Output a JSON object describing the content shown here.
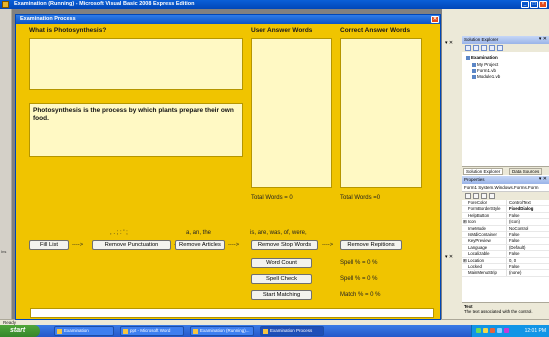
{
  "vs_window": {
    "title": "Examination (Running) - Microsoft Visual Basic 2008 Express Edition",
    "status": "Ready"
  },
  "form": {
    "title": "Examination Process",
    "question_label": "What is Photosynthesis?",
    "answer_text": "Photosynthesis is the process by which plants prepare their own food.",
    "user_words_label": "User Answer Words",
    "correct_words_label": "Correct Answer Words",
    "user_total": "Total Words = 0",
    "correct_total": "Total Words =0",
    "punct_hint": ", . ; : ' ;",
    "articles_hint": "a, an, the",
    "stopwords_hint": "is, are, was, of, were,",
    "buttons": {
      "fill_list": "Fill List",
      "remove_punct": "Remove Punctuation",
      "remove_articles": "Remove Articles",
      "remove_stop": "Remove Stop Words",
      "remove_rep": "Remove Repitions",
      "word_count": "Word Count",
      "spell_check": "Spell Check",
      "start_matching": "Start Matching"
    },
    "arrow": "---->",
    "spell1": "Spell % =  0 %",
    "spell2": "Spell % =  0 %",
    "match": "Match % =  0 %"
  },
  "solution_explorer": {
    "title": "Solution Explorer",
    "items": [
      "Examination",
      "My Project",
      "Form1.vb",
      "Module1.vb"
    ],
    "tab1": "Solution Explorer",
    "tab2": "Data Sources"
  },
  "properties": {
    "title": "Properties",
    "subject": "Form1  System.Windows.Forms.Form",
    "rows": [
      {
        "name": "ForeColor",
        "value": "ControlText"
      },
      {
        "name": "FormBorderStyle",
        "value": "FixedDialog"
      },
      {
        "name": "HelpButton",
        "value": "False"
      },
      {
        "name": "Icon",
        "value": "(Icon)"
      },
      {
        "name": "ImeMode",
        "value": "NoControl"
      },
      {
        "name": "IsMdiContainer",
        "value": "False"
      },
      {
        "name": "KeyPreview",
        "value": "False"
      },
      {
        "name": "Language",
        "value": "(Default)"
      },
      {
        "name": "Localizable",
        "value": "False"
      },
      {
        "name": "Location",
        "value": "0, 0"
      },
      {
        "name": "Locked",
        "value": "False"
      },
      {
        "name": "MainMenuStrip",
        "value": "(none)"
      }
    ],
    "desc_title": "Text",
    "desc_text": "The text associated with the control."
  },
  "taskbar": {
    "start": "start",
    "tasks": [
      "Examination",
      "ppt - Microsoft Word",
      "Examination (Running)...",
      "Examination Process"
    ],
    "clock": "12:01 PM"
  }
}
